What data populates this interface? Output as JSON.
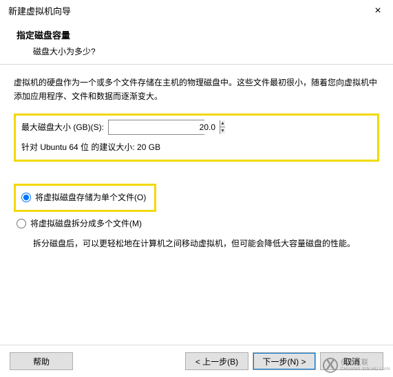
{
  "window": {
    "title": "新建虚拟机向导",
    "close_label": "×"
  },
  "header": {
    "heading": "指定磁盘容量",
    "subheading": "磁盘大小为多少?"
  },
  "content": {
    "description": "虚拟机的硬盘作为一个或多个文件存储在主机的物理磁盘中。这些文件最初很小，随着您向虚拟机中添加应用程序、文件和数据而逐渐变大。",
    "size_label": "最大磁盘大小 (GB)(S):",
    "size_value": "20.0",
    "recommended": "针对 Ubuntu 64 位 的建议大小: 20 GB",
    "radio_single": "将虚拟磁盘存储为单个文件(O)",
    "radio_split": "将虚拟磁盘拆分成多个文件(M)",
    "split_help": "拆分磁盘后，可以更轻松地在计算机之间移动虚拟机，但可能会降低大容量磁盘的性能。"
  },
  "footer": {
    "help": "帮助",
    "back": "< 上一步(B)",
    "next": "下一步(N) >",
    "cancel": "取消"
  },
  "watermark": {
    "brand": "创新互联",
    "sub": "CHUANG XIN HU LIAN"
  }
}
